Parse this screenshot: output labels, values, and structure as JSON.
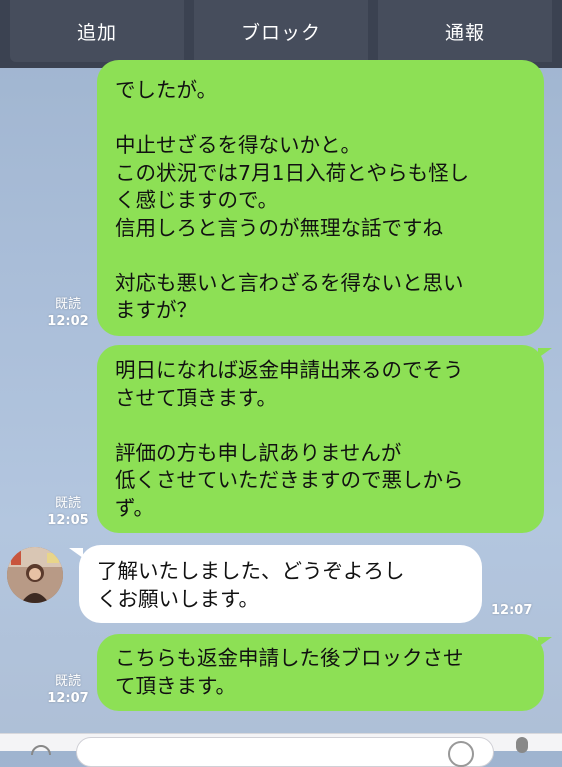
{
  "toolbar": {
    "add_label": "追加",
    "block_label": "ブロック",
    "report_label": "通報"
  },
  "messages": [
    {
      "direction": "outgoing",
      "lines": [
        "でしたが。",
        "",
        "中止せざるを得ないかと。",
        "この状況では7月1日入荷とやらも怪し",
        "く感じますので。",
        "信用しろと言うのが無理な話ですね",
        "",
        "対応も悪いと言わざるを得ないと思い",
        "ますが？"
      ],
      "read": "既読",
      "time": "12:02"
    },
    {
      "direction": "outgoing",
      "lines": [
        "明日になれば返金申請出来るのでそう",
        "させて頂きます。",
        "",
        "評価の方も申し訳ありませんが",
        "低くさせていただきますので悪しから",
        "ず。"
      ],
      "read": "既読",
      "time": "12:05"
    },
    {
      "direction": "incoming",
      "lines": [
        "了解いたしました、どうぞよろし",
        "くお願いします。"
      ],
      "time": "12:07"
    },
    {
      "direction": "outgoing",
      "lines": [
        "こちらも返金申請した後ブロックさせ",
        "て頂きます。"
      ],
      "read": "既読",
      "time": "12:07"
    }
  ],
  "colors": {
    "outgoing_bubble": "#8de055",
    "incoming_bubble": "#ffffff",
    "toolbar_bg": "#3b4251"
  },
  "icons": {
    "avatar": "user-avatar",
    "menu": "menu-icon",
    "emoji": "emoji-icon",
    "mic": "mic-icon"
  }
}
